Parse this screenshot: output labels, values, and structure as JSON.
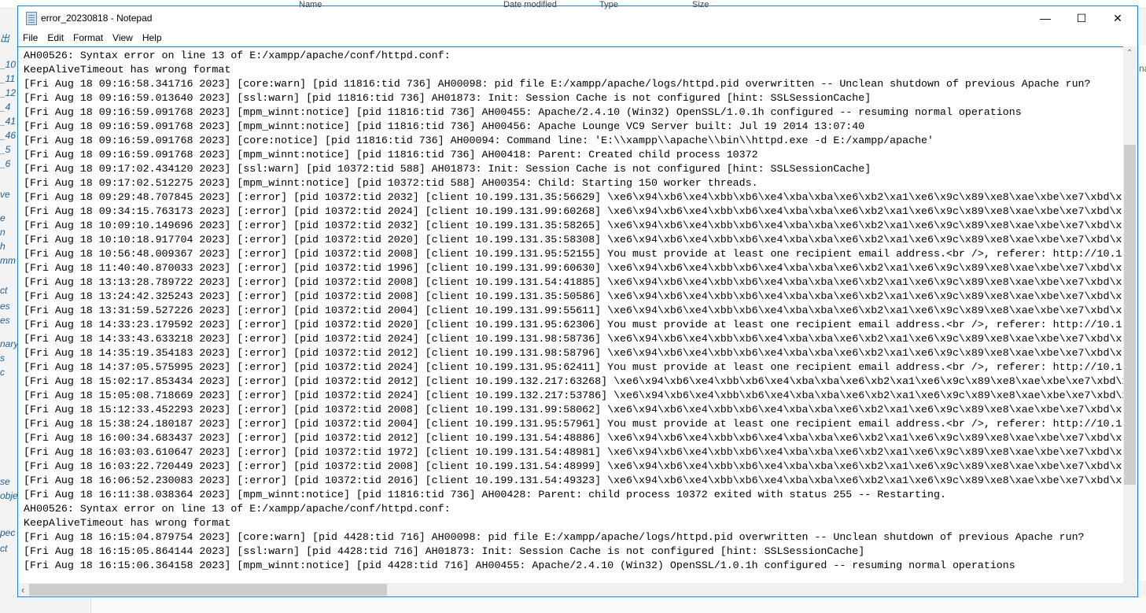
{
  "background": {
    "columns": [
      "Name",
      "Date modified",
      "Type",
      "Size"
    ],
    "left_fragments": [
      "出",
      "_10",
      "_11",
      "_12",
      "_4",
      "_41",
      "_46",
      "_5",
      "_6",
      "ve",
      "e",
      "n",
      "h",
      "mm",
      "ct",
      "es",
      "es",
      "nary",
      "s",
      "c",
      "se",
      "obje",
      "pec",
      "ct"
    ],
    "right_fragment": "na"
  },
  "window": {
    "title": "error_20230818 - Notepad",
    "minimize": "—",
    "maximize": "☐",
    "close": "✕"
  },
  "menu": [
    "File",
    "Edit",
    "Format",
    "View",
    "Help"
  ],
  "editor": {
    "lines": [
      "AH00526: Syntax error on line 13 of E:/xampp/apache/conf/httpd.conf:",
      "KeepAliveTimeout has wrong format",
      "[Fri Aug 18 09:16:58.341716 2023] [core:warn] [pid 11816:tid 736] AH00098: pid file E:/xampp/apache/logs/httpd.pid overwritten -- Unclean shutdown of previous Apache run?",
      "[Fri Aug 18 09:16:59.013640 2023] [ssl:warn] [pid 11816:tid 736] AH01873: Init: Session Cache is not configured [hint: SSLSessionCache]",
      "[Fri Aug 18 09:16:59.091768 2023] [mpm_winnt:notice] [pid 11816:tid 736] AH00455: Apache/2.4.10 (Win32) OpenSSL/1.0.1h configured -- resuming normal operations",
      "[Fri Aug 18 09:16:59.091768 2023] [mpm_winnt:notice] [pid 11816:tid 736] AH00456: Apache Lounge VC9 Server built: Jul 19 2014 13:07:40",
      "[Fri Aug 18 09:16:59.091768 2023] [core:notice] [pid 11816:tid 736] AH00094: Command line: 'E:\\\\xampp\\\\apache\\\\bin\\\\httpd.exe -d E:/xampp/apache'",
      "[Fri Aug 18 09:16:59.091768 2023] [mpm_winnt:notice] [pid 11816:tid 736] AH00418: Parent: Created child process 10372",
      "[Fri Aug 18 09:17:02.434120 2023] [ssl:warn] [pid 10372:tid 588] AH01873: Init: Session Cache is not configured [hint: SSLSessionCache]",
      "[Fri Aug 18 09:17:02.512275 2023] [mpm_winnt:notice] [pid 10372:tid 588] AH00354: Child: Starting 150 worker threads.",
      "[Fri Aug 18 09:29:48.707845 2023] [:error] [pid 10372:tid 2032] [client 10.199.131.35:56629] \\xe6\\x94\\xb6\\xe4\\xbb\\xb6\\xe4\\xba\\xba\\xe6\\xb2\\xa1\\xe6\\x9c\\x89\\xe8\\xae\\xbe\\xe7\\xbd\\x",
      "[Fri Aug 18 09:34:15.763173 2023] [:error] [pid 10372:tid 2024] [client 10.199.131.99:60268] \\xe6\\x94\\xb6\\xe4\\xbb\\xb6\\xe4\\xba\\xba\\xe6\\xb2\\xa1\\xe6\\x9c\\x89\\xe8\\xae\\xbe\\xe7\\xbd\\x",
      "[Fri Aug 18 10:09:10.149696 2023] [:error] [pid 10372:tid 2032] [client 10.199.131.35:58265] \\xe6\\x94\\xb6\\xe4\\xbb\\xb6\\xe4\\xba\\xba\\xe6\\xb2\\xa1\\xe6\\x9c\\x89\\xe8\\xae\\xbe\\xe7\\xbd\\x",
      "[Fri Aug 18 10:10:18.917704 2023] [:error] [pid 10372:tid 2020] [client 10.199.131.35:58308] \\xe6\\x94\\xb6\\xe4\\xbb\\xb6\\xe4\\xba\\xba\\xe6\\xb2\\xa1\\xe6\\x9c\\x89\\xe8\\xae\\xbe\\xe7\\xbd\\x",
      "[Fri Aug 18 10:56:48.009367 2023] [:error] [pid 10372:tid 2008] [client 10.199.131.95:52155] You must provide at least one recipient email address.<br />, referer: http://10.1",
      "[Fri Aug 18 11:40:40.870033 2023] [:error] [pid 10372:tid 1996] [client 10.199.131.99:60630] \\xe6\\x94\\xb6\\xe4\\xbb\\xb6\\xe4\\xba\\xba\\xe6\\xb2\\xa1\\xe6\\x9c\\x89\\xe8\\xae\\xbe\\xe7\\xbd\\x",
      "[Fri Aug 18 13:13:28.789722 2023] [:error] [pid 10372:tid 2008] [client 10.199.131.54:41885] \\xe6\\x94\\xb6\\xe4\\xbb\\xb6\\xe4\\xba\\xba\\xe6\\xb2\\xa1\\xe6\\x9c\\x89\\xe8\\xae\\xbe\\xe7\\xbd\\x",
      "[Fri Aug 18 13:24:42.325243 2023] [:error] [pid 10372:tid 2008] [client 10.199.131.35:50586] \\xe6\\x94\\xb6\\xe4\\xbb\\xb6\\xe4\\xba\\xba\\xe6\\xb2\\xa1\\xe6\\x9c\\x89\\xe8\\xae\\xbe\\xe7\\xbd\\x",
      "[Fri Aug 18 13:31:59.527226 2023] [:error] [pid 10372:tid 2004] [client 10.199.131.99:55611] \\xe6\\x94\\xb6\\xe4\\xbb\\xb6\\xe4\\xba\\xba\\xe6\\xb2\\xa1\\xe6\\x9c\\x89\\xe8\\xae\\xbe\\xe7\\xbd\\x",
      "[Fri Aug 18 14:33:23.179592 2023] [:error] [pid 10372:tid 2020] [client 10.199.131.95:62306] You must provide at least one recipient email address.<br />, referer: http://10.1",
      "[Fri Aug 18 14:33:43.633218 2023] [:error] [pid 10372:tid 2024] [client 10.199.131.98:58736] \\xe6\\x94\\xb6\\xe4\\xbb\\xb6\\xe4\\xba\\xba\\xe6\\xb2\\xa1\\xe6\\x9c\\x89\\xe8\\xae\\xbe\\xe7\\xbd\\x",
      "[Fri Aug 18 14:35:19.354183 2023] [:error] [pid 10372:tid 2012] [client 10.199.131.98:58796] \\xe6\\x94\\xb6\\xe4\\xbb\\xb6\\xe4\\xba\\xba\\xe6\\xb2\\xa1\\xe6\\x9c\\x89\\xe8\\xae\\xbe\\xe7\\xbd\\x",
      "[Fri Aug 18 14:37:05.575995 2023] [:error] [pid 10372:tid 2024] [client 10.199.131.95:62411] You must provide at least one recipient email address.<br />, referer: http://10.1",
      "[Fri Aug 18 15:02:17.853434 2023] [:error] [pid 10372:tid 2012] [client 10.199.132.217:63268] \\xe6\\x94\\xb6\\xe4\\xbb\\xb6\\xe4\\xba\\xba\\xe6\\xb2\\xa1\\xe6\\x9c\\x89\\xe8\\xae\\xbe\\xe7\\xbd\\x",
      "[Fri Aug 18 15:05:08.718669 2023] [:error] [pid 10372:tid 2024] [client 10.199.132.217:53786] \\xe6\\x94\\xb6\\xe4\\xbb\\xb6\\xe4\\xba\\xba\\xe6\\xb2\\xa1\\xe6\\x9c\\x89\\xe8\\xae\\xbe\\xe7\\xbd\\x",
      "[Fri Aug 18 15:12:33.452293 2023] [:error] [pid 10372:tid 2008] [client 10.199.131.99:58062] \\xe6\\x94\\xb6\\xe4\\xbb\\xb6\\xe4\\xba\\xba\\xe6\\xb2\\xa1\\xe6\\x9c\\x89\\xe8\\xae\\xbe\\xe7\\xbd\\x",
      "[Fri Aug 18 15:38:24.180187 2023] [:error] [pid 10372:tid 2004] [client 10.199.131.95:57961] You must provide at least one recipient email address.<br />, referer: http://10.1",
      "[Fri Aug 18 16:00:34.683437 2023] [:error] [pid 10372:tid 2012] [client 10.199.131.54:48886] \\xe6\\x94\\xb6\\xe4\\xbb\\xb6\\xe4\\xba\\xba\\xe6\\xb2\\xa1\\xe6\\x9c\\x89\\xe8\\xae\\xbe\\xe7\\xbd\\x",
      "[Fri Aug 18 16:03:03.610647 2023] [:error] [pid 10372:tid 1972] [client 10.199.131.54:48981] \\xe6\\x94\\xb6\\xe4\\xbb\\xb6\\xe4\\xba\\xba\\xe6\\xb2\\xa1\\xe6\\x9c\\x89\\xe8\\xae\\xbe\\xe7\\xbd\\x",
      "[Fri Aug 18 16:03:22.720449 2023] [:error] [pid 10372:tid 2008] [client 10.199.131.54:48999] \\xe6\\x94\\xb6\\xe4\\xbb\\xb6\\xe4\\xba\\xba\\xe6\\xb2\\xa1\\xe6\\x9c\\x89\\xe8\\xae\\xbe\\xe7\\xbd\\x",
      "[Fri Aug 18 16:06:52.230083 2023] [:error] [pid 10372:tid 2016] [client 10.199.131.54:49323] \\xe6\\x94\\xb6\\xe4\\xbb\\xb6\\xe4\\xba\\xba\\xe6\\xb2\\xa1\\xe6\\x9c\\x89\\xe8\\xae\\xbe\\xe7\\xbd\\x",
      "[Fri Aug 18 16:11:38.038364 2023] [mpm_winnt:notice] [pid 11816:tid 736] AH00428: Parent: child process 10372 exited with status 255 -- Restarting.",
      "AH00526: Syntax error on line 13 of E:/xampp/apache/conf/httpd.conf:",
      "KeepAliveTimeout has wrong format",
      "[Fri Aug 18 16:15:04.879754 2023] [core:warn] [pid 4428:tid 716] AH00098: pid file E:/xampp/apache/logs/httpd.pid overwritten -- Unclean shutdown of previous Apache run?",
      "[Fri Aug 18 16:15:05.864144 2023] [ssl:warn] [pid 4428:tid 716] AH01873: Init: Session Cache is not configured [hint: SSLSessionCache]",
      "[Fri Aug 18 16:15:06.364158 2023] [mpm_winnt:notice] [pid 4428:tid 716] AH00455: Apache/2.4.10 (Win32) OpenSSL/1.0.1h configured -- resuming normal operations"
    ]
  },
  "scrollbars": {
    "vertical_position_fraction": 0.2,
    "horizontal_position_fraction": 0.0,
    "up_arrow": "⌃",
    "left_arrow": "‹"
  }
}
